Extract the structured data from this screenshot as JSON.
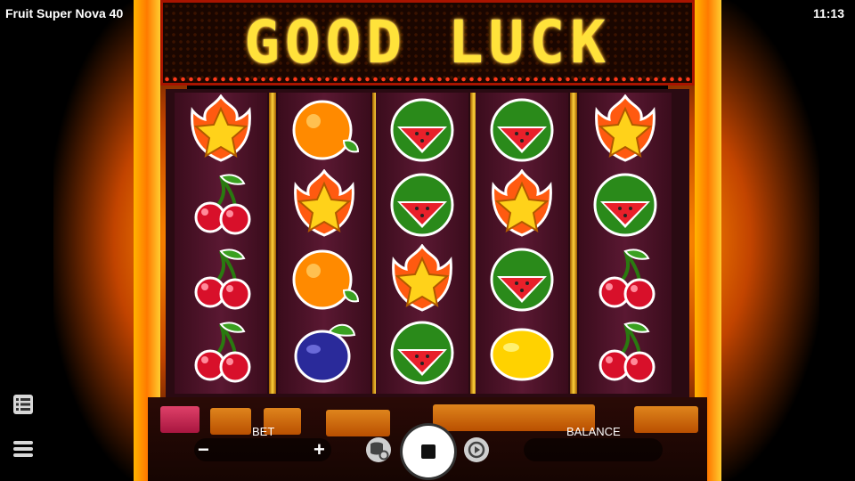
{
  "status_bar": {
    "title": "Fruit Super Nova 40",
    "clock": "11:13"
  },
  "marquee": {
    "text": "GOOD LUCK"
  },
  "reels": [
    [
      "star",
      "cherry",
      "cherry",
      "cherry"
    ],
    [
      "orange",
      "star",
      "orange",
      "plum"
    ],
    [
      "watermelon",
      "watermelon",
      "star",
      "watermelon"
    ],
    [
      "watermelon",
      "star",
      "watermelon",
      "lemon"
    ],
    [
      "star",
      "watermelon",
      "cherry",
      "cherry"
    ]
  ],
  "controls": {
    "bet_label": "BET",
    "balance_label": "BALANCE",
    "minus": "−",
    "plus": "+"
  },
  "icons": {
    "menu": "hamburger-icon",
    "paytable": "list-icon",
    "autoplay": "autoplay-icon",
    "stop": "stop-icon",
    "coins": "coin-settings-icon"
  },
  "colors": {
    "accent": "#ffb400",
    "marquee_text": "#ffe23a",
    "reel_bg": "#4a1428"
  }
}
